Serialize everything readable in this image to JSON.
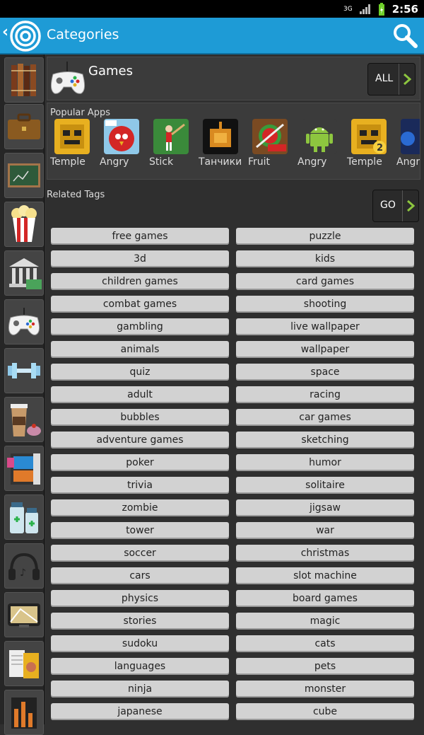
{
  "status": {
    "time": "2:56",
    "network": "3G"
  },
  "appbar": {
    "title": "Categories"
  },
  "sidebar": {
    "items": [
      "books-icon",
      "briefcase-icon",
      "chalkboard-icon",
      "popcorn-icon",
      "bank-icon",
      "gamepad-icon",
      "dumbbell-icon",
      "coffee-icon",
      "film-icon",
      "medicine-icon",
      "headphones-icon",
      "navigation-icon",
      "magazines-icon",
      "equalizer-icon"
    ]
  },
  "category": {
    "title": "Games",
    "all_label": "ALL"
  },
  "popular": {
    "label": "Popular Apps",
    "apps": [
      {
        "name": "Temple"
      },
      {
        "name": "Angry"
      },
      {
        "name": "Stick"
      },
      {
        "name": "Танчики"
      },
      {
        "name": "Fruit"
      },
      {
        "name": "Angry"
      },
      {
        "name": "Temple"
      },
      {
        "name": "Angry"
      }
    ]
  },
  "related": {
    "label": "Related Tags",
    "go_label": "GO",
    "tags": [
      "free games",
      "puzzle",
      "3d",
      "kids",
      "children games",
      "card games",
      "combat games",
      "shooting",
      "gambling",
      "live wallpaper",
      "animals",
      "wallpaper",
      "quiz",
      "space",
      "adult",
      "racing",
      "bubbles",
      "car games",
      "adventure games",
      "sketching",
      "poker",
      "humor",
      "trivia",
      "solitaire",
      "zombie",
      "jigsaw",
      "tower",
      "war",
      "soccer",
      "christmas",
      "cars",
      "slot machine",
      "physics",
      "board games",
      "stories",
      "magic",
      "sudoku",
      "cats",
      "languages",
      "pets",
      "ninja",
      "monster",
      "japanese",
      "cube"
    ]
  },
  "colors": {
    "accent": "#1e9bd6",
    "chevron": "#8dc63f"
  }
}
